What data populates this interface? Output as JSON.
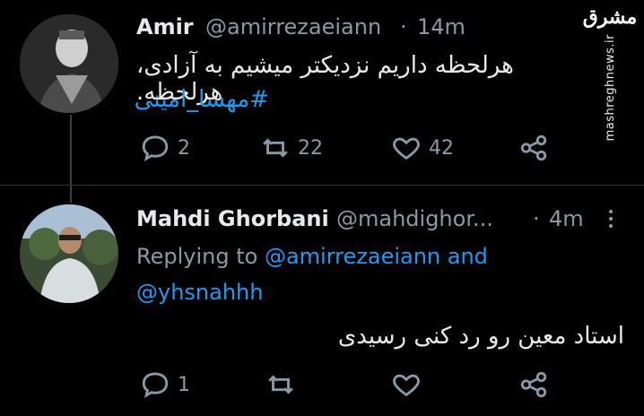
{
  "tweet1": {
    "name": "Amir",
    "handle": "@amirrezaeiann",
    "dot": "·",
    "time": "14m",
    "text": "هرلحظه داریم نزدیکتر میشیم به آزادی، هرلحظه.",
    "hashtag": "#مهسا_امینی",
    "actions": {
      "reply": "2",
      "retweet": "22",
      "like": "42"
    }
  },
  "tweet2": {
    "name": "Mahdi Ghorbani",
    "handle": "@mahdighor...",
    "dot": "·",
    "time": "4m",
    "replying_prefix": "Replying to",
    "replying_user1": "@amirrezaeiann",
    "replying_and": "and",
    "replying_user2": "@yhsnahhh",
    "text": "استاد معین رو رد کنی رسیدی",
    "actions": {
      "reply": "1",
      "retweet": "",
      "like": ""
    }
  },
  "watermark": {
    "logo": "مشرق",
    "vertical_text": "mashreghnews.ir"
  },
  "icons": {
    "reply": "reply-icon",
    "retweet": "retweet-icon",
    "like": "heart-icon",
    "share": "share-icon",
    "more": "more-options-icon"
  },
  "colors": {
    "background": "#000000",
    "text": "#e7e9ea",
    "muted": "#8b98a5",
    "link": "#1d9bf0"
  }
}
